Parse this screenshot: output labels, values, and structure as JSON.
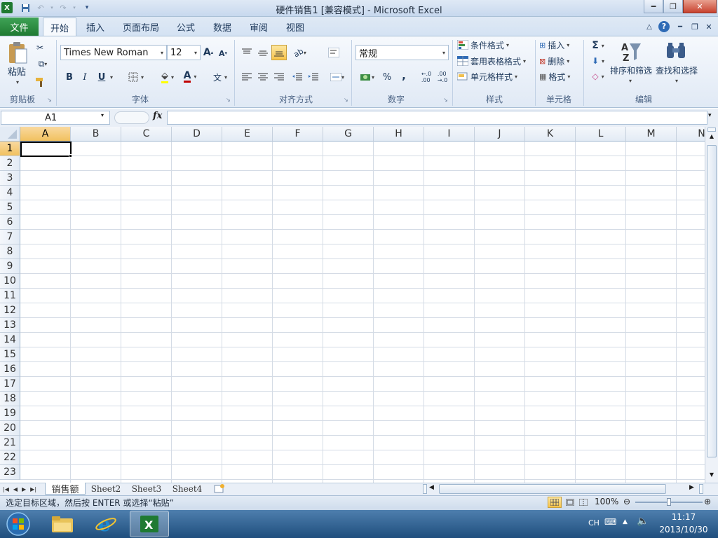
{
  "app": {
    "title": "硬件销售1  [兼容模式]  -  Microsoft Excel",
    "accent": "#1f7a32",
    "window_buttons": [
      "minimize-icon",
      "restore-icon",
      "close-icon"
    ]
  },
  "quick_access": [
    "excel-logo-icon",
    "save-icon",
    "undo-icon",
    "redo-icon",
    "customize-icon"
  ],
  "tabs": [
    {
      "label": "文件"
    },
    {
      "label": "开始"
    },
    {
      "label": "插入"
    },
    {
      "label": "页面布局"
    },
    {
      "label": "公式"
    },
    {
      "label": "数据"
    },
    {
      "label": "审阅"
    },
    {
      "label": "视图"
    }
  ],
  "ribbon": {
    "clipboard": {
      "paste": "粘贴",
      "group": "剪贴板"
    },
    "font": {
      "name": "Times New Roman",
      "size": "12",
      "group": "字体",
      "bold": "B",
      "italic": "I",
      "underline": "U"
    },
    "alignment": {
      "group": "对齐方式"
    },
    "number": {
      "format": "常规",
      "percent": "%",
      "comma": ",",
      "group": "数字"
    },
    "styles": {
      "conditional": "条件格式",
      "table": "套用表格格式",
      "cell": "单元格样式",
      "group": "样式"
    },
    "cells": {
      "insert": "插入",
      "delete": "删除",
      "format": "格式",
      "group": "单元格"
    },
    "editing": {
      "sum": "Σ",
      "sort": "排序和筛选",
      "find": "查找和选择",
      "group": "编辑"
    }
  },
  "formula_bar": {
    "name_box": "A1",
    "fx": "fx",
    "value": ""
  },
  "grid": {
    "columns": [
      "A",
      "B",
      "C",
      "D",
      "E",
      "F",
      "G",
      "H",
      "I",
      "J",
      "K",
      "L",
      "M",
      "N"
    ],
    "rows": [
      "1",
      "2",
      "3",
      "4",
      "5",
      "6",
      "7",
      "8",
      "9",
      "10",
      "11",
      "12",
      "13",
      "14",
      "15",
      "16",
      "17",
      "18",
      "19",
      "20",
      "21",
      "22",
      "23"
    ],
    "selected_cell": "A1"
  },
  "sheets": [
    {
      "label": "销售额",
      "active": true
    },
    {
      "label": "Sheet2"
    },
    {
      "label": "Sheet3"
    },
    {
      "label": "Sheet4"
    }
  ],
  "status": {
    "message": "选定目标区域，然后按 ENTER 或选择“粘贴”",
    "zoom": "100%"
  },
  "taskbar": {
    "ime": "CH",
    "time": "11:17",
    "date": "2013/10/30"
  }
}
